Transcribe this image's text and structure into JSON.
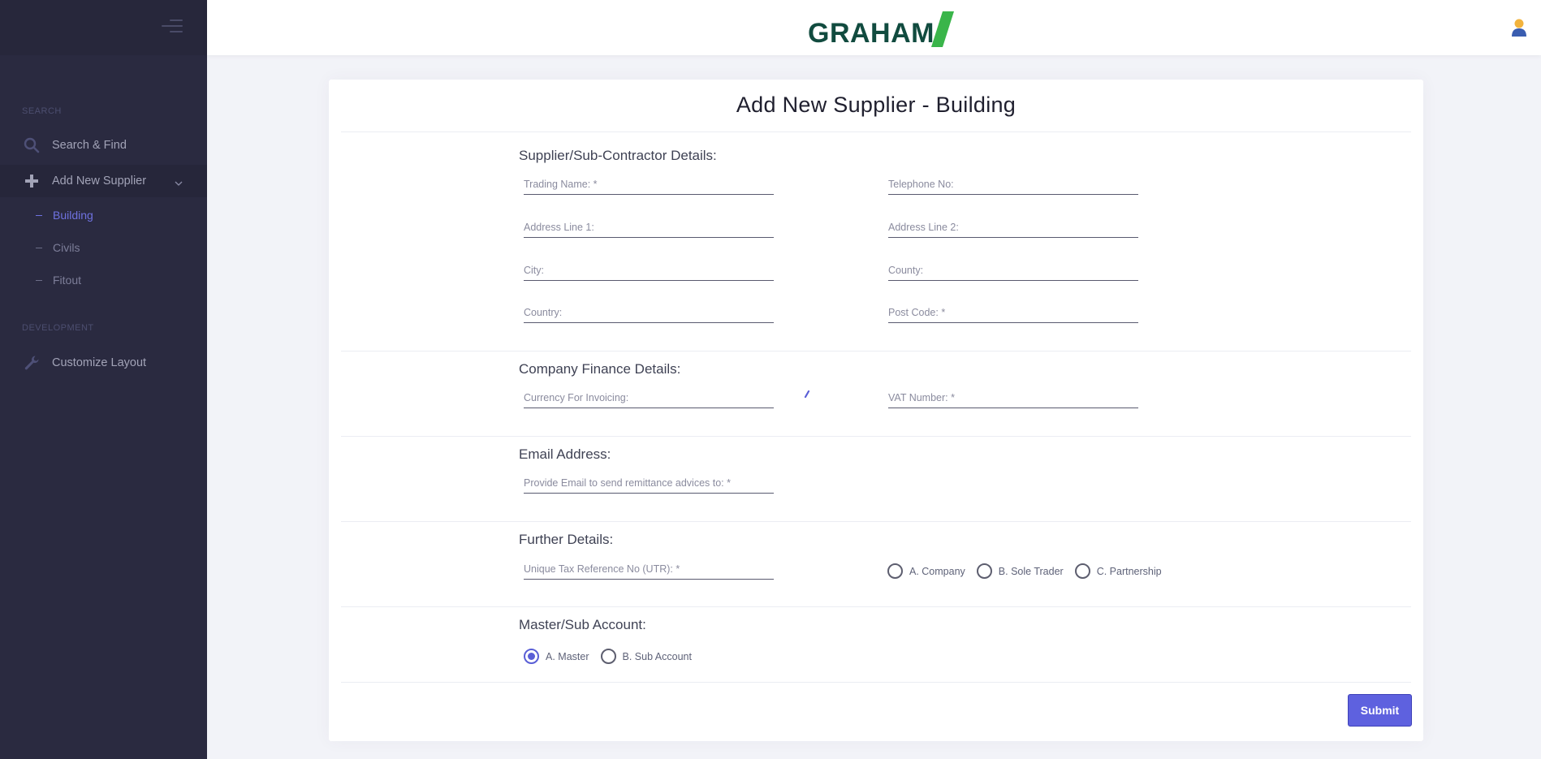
{
  "sidebar": {
    "sections": [
      {
        "label": "SEARCH"
      },
      {
        "label": "DEVELOPMENT"
      }
    ],
    "items": [
      {
        "label": "Search & Find",
        "icon": "search-icon"
      },
      {
        "label": "Add New Supplier",
        "icon": "plus-icon"
      },
      {
        "label": "Customize Layout",
        "icon": "wrench-icon"
      }
    ],
    "sub_items": [
      {
        "label": "Building"
      },
      {
        "label": "Civils"
      },
      {
        "label": "Fitout"
      }
    ]
  },
  "header": {
    "logo_text": "GRAHAM",
    "brand_colors": {
      "text": "#114b3f",
      "slash": "#3ab54a"
    }
  },
  "form": {
    "title": "Add New Supplier - Building",
    "sections": {
      "supplier": "Supplier/Sub-Contractor Details:",
      "finance": "Company Finance Details:",
      "email": "Email Address:",
      "further": "Further Details:",
      "master": "Master/Sub Account:"
    },
    "fields": {
      "trading_name": {
        "placeholder": "Trading Name: *",
        "value": ""
      },
      "telephone": {
        "placeholder": "Telephone No:",
        "value": ""
      },
      "address1": {
        "placeholder": "Address Line 1:",
        "value": ""
      },
      "address2": {
        "placeholder": "Address Line 2:",
        "value": ""
      },
      "city": {
        "placeholder": "City:",
        "value": ""
      },
      "county": {
        "placeholder": "County:",
        "value": ""
      },
      "country": {
        "placeholder": "Country:",
        "value": ""
      },
      "postcode": {
        "placeholder": "Post Code: *",
        "value": ""
      },
      "currency": {
        "placeholder": "Currency For Invoicing:",
        "value": ""
      },
      "vat": {
        "placeholder": "VAT Number: *",
        "value": ""
      },
      "email": {
        "placeholder": "Provide Email to send remittance advices to: *",
        "value": ""
      },
      "utr": {
        "placeholder": "Unique Tax Reference No (UTR): *",
        "value": ""
      }
    },
    "company_type": [
      {
        "label": "A. Company",
        "checked": false
      },
      {
        "label": "B. Sole Trader",
        "checked": false
      },
      {
        "label": "C. Partnership",
        "checked": false
      }
    ],
    "account_type": [
      {
        "label": "A. Master",
        "checked": true
      },
      {
        "label": "B. Sub Account",
        "checked": false
      }
    ],
    "submit_label": "Submit"
  },
  "colors": {
    "accent": "#5e61df",
    "sidebar_bg": "#2a2a40"
  }
}
